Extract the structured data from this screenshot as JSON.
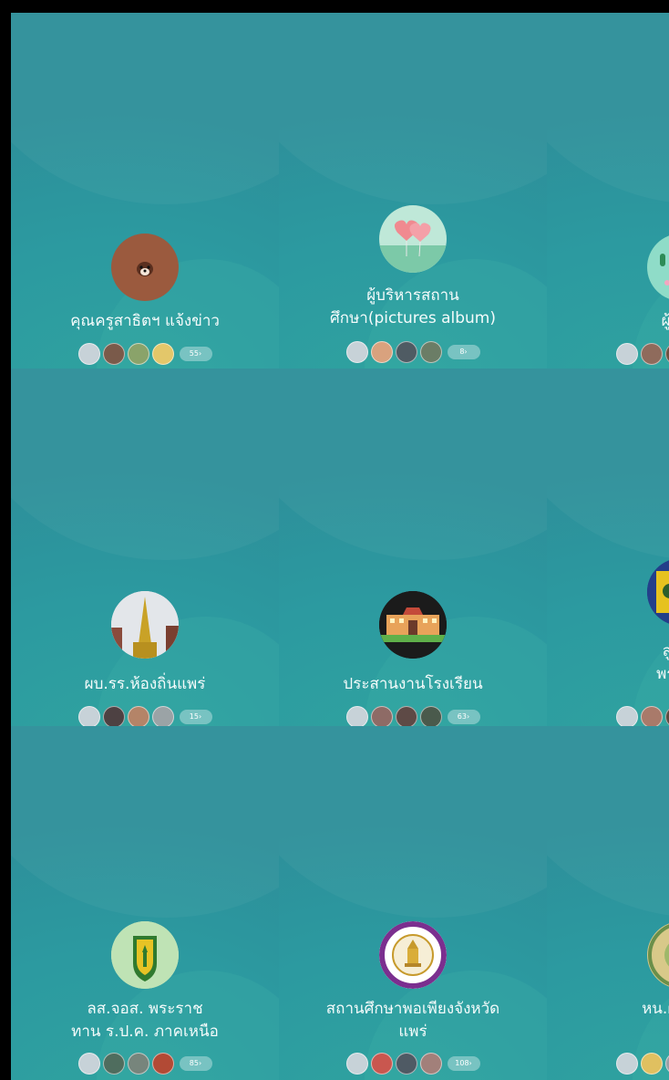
{
  "groups": [
    {
      "name": "คุณครูสาธิตฯ แจ้งข่าว",
      "count": "55›",
      "avatar": "bear-icon"
    },
    {
      "name": "ผู้บริหารสถาน\nศึกษา(pictures  album)",
      "count": "8›",
      "avatar": "heart-balloons-icon"
    },
    {
      "name": "ผู้บริหา",
      "count": "",
      "avatar": "cactus-icon"
    },
    {
      "name": "ผบ.รร.ห้องถิ่นแพร่",
      "count": "15›",
      "avatar": "pagoda-icon"
    },
    {
      "name": "ประสานงานโรงเรียน",
      "count": "63›",
      "avatar": "school-building-icon"
    },
    {
      "name": "ลูกเสือ\nพระราช",
      "count": "",
      "avatar": "scout-emblem-icon"
    },
    {
      "name": "ลส.จอส. พระราช\nทาน ร.ป.ค. ภาคเหนือ",
      "count": "85›",
      "avatar": "scout-badge-icon"
    },
    {
      "name": "สถานศึกษาพอเพียงจังหวัด\nแพร่",
      "count": "108›",
      "avatar": "royal-seal-icon"
    },
    {
      "name": "หน.ฝ่าย&หน\nล",
      "count": "",
      "avatar": "office-seal-icon"
    }
  ]
}
